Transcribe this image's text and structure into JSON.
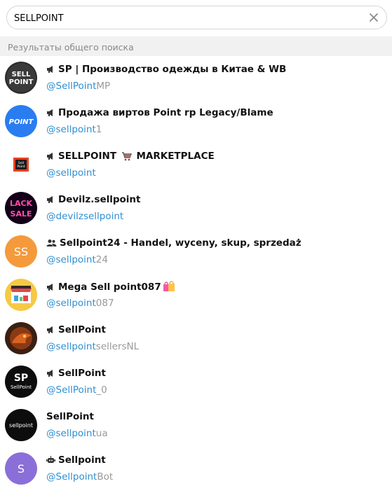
{
  "search": {
    "value": "SELLPOINT"
  },
  "section_header": "Результаты общего поиска",
  "results": [
    {
      "title": "SP | Производство одежды в Китае & WB",
      "type": "channel",
      "u_hl": "@SellPoint",
      "u_rest": "MP",
      "avatar": "sp-dark",
      "avatar_text": "SELL POINT"
    },
    {
      "title": "Продажа виртов Point rp Legacy/Blame",
      "type": "channel",
      "u_hl": "@sellpoint",
      "u_rest": "1",
      "avatar": "point-blue",
      "avatar_text": "POINT"
    },
    {
      "title": "SELLPOINT",
      "title_suffix": "MARKETPLACE",
      "type": "channel",
      "u_hl": "@sellpoint",
      "u_rest": "",
      "avatar": "sellpoint-logo",
      "avatar_text": "Sell Point"
    },
    {
      "title": "Devilz.sellpoint",
      "type": "channel",
      "u_hl": "@devilzsellpoint",
      "u_rest": "",
      "avatar": "neon",
      "avatar_text": "BLACK SALE"
    },
    {
      "title": "Sellpoint24 - Handel, wyceny, skup, sprzedaż",
      "type": "group",
      "u_hl": "@sellpoint",
      "u_rest": "24",
      "avatar": "initials-orange",
      "avatar_text": "SS"
    },
    {
      "title": "Mega Sell point087",
      "type": "channel",
      "u_hl": "@sellpoint",
      "u_rest": "087",
      "avatar": "store",
      "avatar_text": "ONLINE STORE"
    },
    {
      "title": "SellPoint",
      "type": "channel",
      "u_hl": "@sellpoint",
      "u_rest": "sellersNL",
      "avatar": "dragon"
    },
    {
      "title": "SellPoint",
      "type": "channel",
      "u_hl": "@SellPoint",
      "u_rest": "_0",
      "avatar": "sp-black",
      "avatar_text": "SP",
      "avatar_sub": "SellPoint"
    },
    {
      "title": "SellPoint",
      "type": "user",
      "u_hl": "@sellpoint",
      "u_rest": "ua",
      "avatar": "sellpoint-black",
      "avatar_text": "sellpoint"
    },
    {
      "title": "Sellpoint",
      "type": "bot",
      "u_hl": "@Sellpoint",
      "u_rest": "Bot",
      "avatar": "initials-purple",
      "avatar_text": "S"
    }
  ],
  "colors": {
    "link": "#2e8fd0",
    "muted": "#999999",
    "orange": "#f59a3c",
    "purple": "#8a6fd8"
  }
}
